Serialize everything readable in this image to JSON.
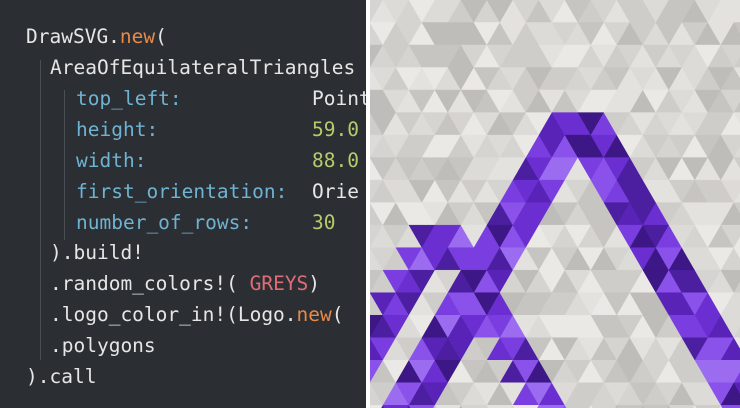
{
  "editor": {
    "lines": [
      {
        "parts": [
          {
            "t": "DrawSVG.",
            "c": "plain"
          },
          {
            "t": "new",
            "c": "kw"
          },
          {
            "t": "(",
            "c": "plain"
          }
        ]
      },
      {
        "parts": [
          {
            "t": "AreaOfEquilateralTriangles",
            "c": "plain"
          }
        ]
      },
      {
        "parts": [
          {
            "t": "top_left:",
            "c": "key"
          },
          {
            "t": "Point",
            "c": "plain"
          }
        ]
      },
      {
        "parts": [
          {
            "t": "height:",
            "c": "key"
          },
          {
            "t": "59.0",
            "c": "num"
          }
        ]
      },
      {
        "parts": [
          {
            "t": "width:",
            "c": "key"
          },
          {
            "t": "88.0",
            "c": "num"
          }
        ]
      },
      {
        "parts": [
          {
            "t": "first_orientation:",
            "c": "key"
          },
          {
            "t": "Orie",
            "c": "plain"
          }
        ]
      },
      {
        "parts": [
          {
            "t": "number_of_rows:",
            "c": "key"
          },
          {
            "t": "30",
            "c": "num"
          }
        ]
      },
      {
        "parts": [
          {
            "t": ").build!",
            "c": "plain"
          }
        ]
      },
      {
        "parts": [
          {
            "t": ".random_colors!( ",
            "c": "plain"
          },
          {
            "t": "GREYS",
            "c": "red"
          },
          {
            "t": ")",
            "c": "plain"
          }
        ]
      },
      {
        "parts": [
          {
            "t": ".logo_color_in!(Logo.",
            "c": "plain"
          },
          {
            "t": "new",
            "c": "kw"
          },
          {
            "t": "(",
            "c": "plain"
          }
        ]
      },
      {
        "parts": [
          {
            "t": ".polygons",
            "c": "plain"
          }
        ]
      },
      {
        "parts": [
          {
            "t": ").call",
            "c": "plain"
          }
        ]
      }
    ]
  },
  "colors": {
    "editor_bg": "#2b2f33",
    "keyword": "#e8894a",
    "key": "#6fb3d2",
    "number": "#b5cc6a",
    "constant": "#e06c75",
    "text": "#e6e6e6",
    "purple_palette": [
      "#4b1fa0",
      "#5a23b8",
      "#6b2fd1",
      "#7a3ee0",
      "#8a52ea",
      "#9b6cf0",
      "#3d1785"
    ],
    "grey_palette": [
      "#cfcdc9",
      "#d6d4d0",
      "#dddbd8",
      "#e4e2df",
      "#c7c5c1",
      "#eae9e6",
      "#bfbdb9"
    ]
  }
}
